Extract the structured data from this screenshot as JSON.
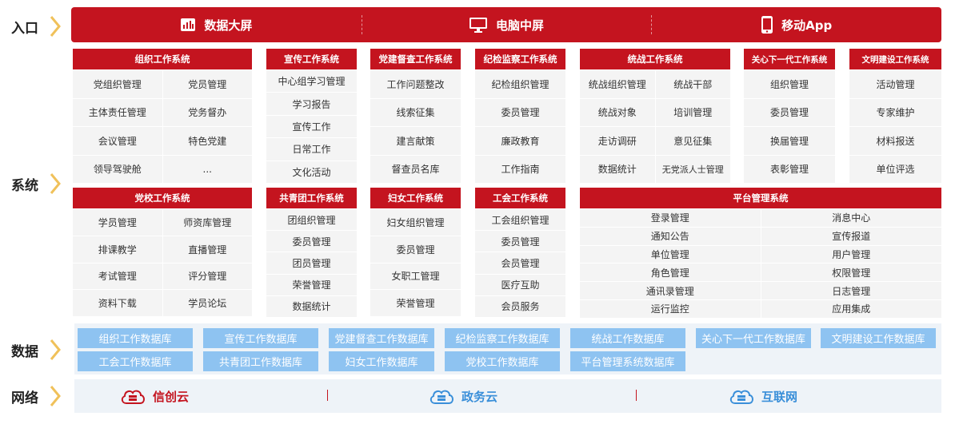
{
  "row_labels": {
    "entry": "入口",
    "system": "系统",
    "data": "数据",
    "network": "网络"
  },
  "entries": [
    {
      "label": "数据大屏",
      "icon": "dashboard-screen-icon"
    },
    {
      "label": "电脑中屏",
      "icon": "desktop-monitor-icon"
    },
    {
      "label": "移动App",
      "icon": "mobile-phone-icon"
    }
  ],
  "modules_top": [
    {
      "title": "组织工作系统",
      "items": [
        "党组织管理",
        "党员管理",
        "主体责任管理",
        "党务督办",
        "会议管理",
        "特色党建",
        "领导驾驶舱",
        "..."
      ]
    },
    {
      "title": "宣传工作系统",
      "items": [
        "中心组学习管理",
        "学习报告",
        "宣传工作",
        "日常工作",
        "文化活动"
      ]
    },
    {
      "title": "党建督查工作系统",
      "items": [
        "工作问题整改",
        "线索征集",
        "建言献策",
        "督查员名库"
      ]
    },
    {
      "title": "纪检监察工作系统",
      "items": [
        "纪检组织管理",
        "委员管理",
        "廉政教育",
        "工作指南"
      ]
    },
    {
      "title": "统战工作系统",
      "items": [
        "统战组织管理",
        "统战干部",
        "统战对象",
        "培训管理",
        "走访调研",
        "意见征集",
        "数据统计",
        "无党派人士管理"
      ]
    },
    {
      "title": "关心下一代工作系统",
      "items": [
        "组织管理",
        "委员管理",
        "换届管理",
        "表彰管理"
      ]
    },
    {
      "title": "文明建设工作系统",
      "items": [
        "活动管理",
        "专家维护",
        "材料报送",
        "单位评选"
      ]
    }
  ],
  "modules_bottom": [
    {
      "title": "党校工作系统",
      "items": [
        "学员管理",
        "师资库管理",
        "排课教学",
        "直播管理",
        "考试管理",
        "评分管理",
        "资料下载",
        "学员论坛"
      ]
    },
    {
      "title": "共青团工作系统",
      "items": [
        "团组织管理",
        "委员管理",
        "团员管理",
        "荣誉管理",
        "数据统计"
      ]
    },
    {
      "title": "妇女工作系统",
      "items": [
        "妇女组织管理",
        "委员管理",
        "女职工管理",
        "荣誉管理"
      ]
    },
    {
      "title": "工会工作系统",
      "items": [
        "工会组织管理",
        "委员管理",
        "会员管理",
        "医疗互助",
        "会员服务"
      ]
    },
    {
      "title": "平台管理系统",
      "items": [
        "登录管理",
        "消息中心",
        "通知公告",
        "宣传报道",
        "单位管理",
        "用户管理",
        "角色管理",
        "权限管理",
        "通讯录管理",
        "日志管理",
        "运行监控",
        "应用集成"
      ]
    }
  ],
  "databases": [
    "组织工作数据库",
    "宣传工作数据库",
    "党建督查工作数据库",
    "纪检监察工作数据库",
    "统战工作数据库",
    "关心下一代工作数据库",
    "文明建设工作数据库",
    "工会工作数据库",
    "共青团工作数据库",
    "妇女工作数据库",
    "党校工作数据库",
    "平台管理系统数据库"
  ],
  "networks": [
    {
      "label": "信创云",
      "color": "#c4141f",
      "icon": "cloud-server-icon"
    },
    {
      "label": "政务云",
      "color": "#3a8fd9",
      "icon": "cloud-server-icon"
    },
    {
      "label": "互联网",
      "color": "#3a8fd9",
      "icon": "cloud-server-icon"
    }
  ],
  "colors": {
    "primary_red": "#c4141f",
    "db_blue": "#8ec3f1",
    "cell_gray": "#f4f4f4",
    "chevron_gold": "#f0c15a"
  }
}
